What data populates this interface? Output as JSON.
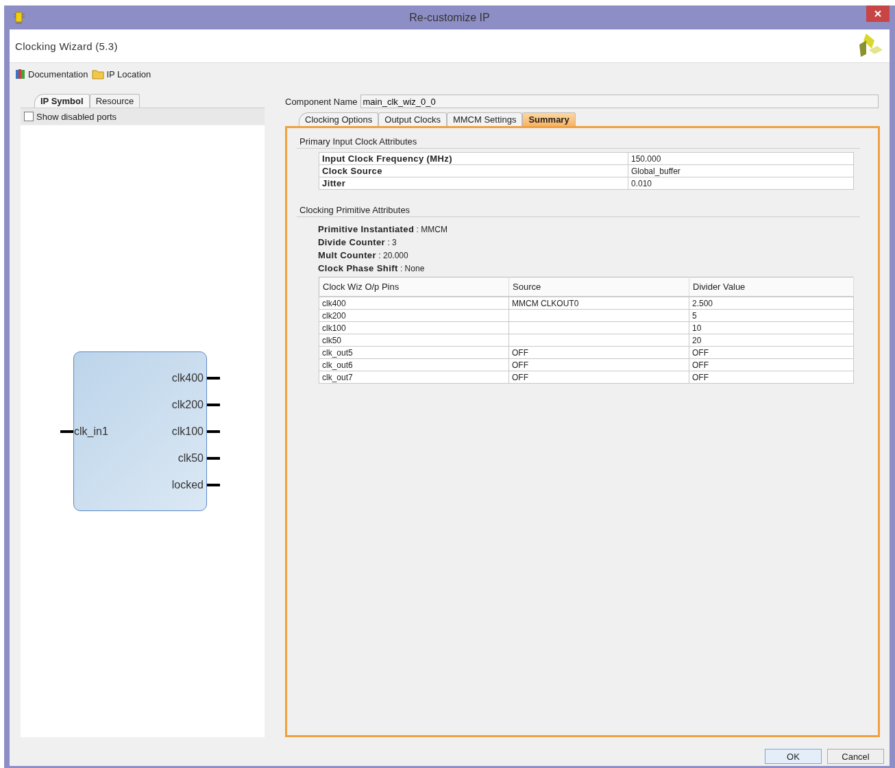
{
  "window": {
    "title": "Re-customize IP"
  },
  "header": {
    "title": "Clocking Wizard (5.3)"
  },
  "toolbar": [
    {
      "kind": "documentation",
      "label": "Documentation"
    },
    {
      "kind": "folder",
      "label": "IP Location"
    }
  ],
  "left_tabs": [
    {
      "label": "IP Symbol",
      "selected": true
    },
    {
      "label": "Resource",
      "selected": false
    }
  ],
  "show_disabled_ports": {
    "label": "Show disabled ports",
    "checked": false
  },
  "ip_symbol": {
    "inputs": [
      "clk_in1"
    ],
    "outputs": [
      "clk400",
      "clk200",
      "clk100",
      "clk50",
      "locked"
    ]
  },
  "component_name": {
    "label": "Component Name",
    "value": "main_clk_wiz_0_0"
  },
  "tabs": [
    {
      "label": "Clocking Options",
      "selected": false
    },
    {
      "label": "Output Clocks",
      "selected": false
    },
    {
      "label": "MMCM Settings",
      "selected": false
    },
    {
      "label": "Summary",
      "selected": true
    }
  ],
  "primary_input": {
    "title": "Primary Input Clock Attributes",
    "rows": [
      [
        "Input Clock Frequency (MHz)",
        "150.000"
      ],
      [
        "Clock Source",
        "Global_buffer"
      ],
      [
        "Jitter",
        "0.010"
      ]
    ]
  },
  "primitive": {
    "title": "Clocking Primitive Attributes",
    "attributes": [
      "**Primitive Instantiated** : MMCM",
      "**Divide Counter** : 3",
      "**Mult Counter** : 20.000",
      "**Clock Phase Shift** : None"
    ],
    "columns": [
      "Clock Wiz O/p Pins",
      "Source",
      "Divider Value"
    ],
    "rows": [
      [
        "clk400",
        "MMCM CLKOUT0",
        "2.500"
      ],
      [
        "clk200",
        "",
        "5"
      ],
      [
        "clk100",
        "",
        "10"
      ],
      [
        "clk50",
        "",
        "20"
      ],
      [
        "clk_out5",
        "OFF",
        "OFF"
      ],
      [
        "clk_out6",
        "OFF",
        "OFF"
      ],
      [
        "clk_out7",
        "OFF",
        "OFF"
      ]
    ]
  },
  "buttons": [
    {
      "label": "OK",
      "default": true
    },
    {
      "label": "Cancel",
      "default": false
    }
  ]
}
